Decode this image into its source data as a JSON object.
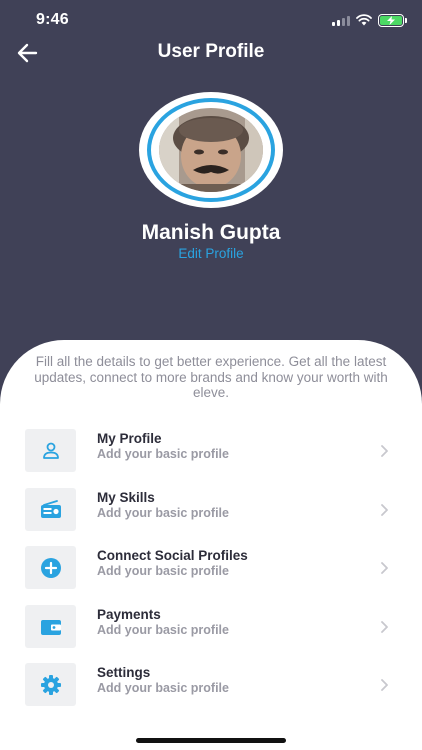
{
  "status_bar": {
    "time": "9:46"
  },
  "header": {
    "title": "User Profile"
  },
  "profile": {
    "name": "Manish Gupta",
    "edit_label": "Edit Profile"
  },
  "intro_text": "Fill all the details to get better experience. Get all the latest updates, connect to more brands and know your worth with eleve.",
  "menu": [
    {
      "title": "My Profile",
      "subtitle": "Add your basic profile",
      "icon": "person-icon"
    },
    {
      "title": "My Skills",
      "subtitle": "Add your basic profile",
      "icon": "radio-icon"
    },
    {
      "title": "Connect Social Profiles",
      "subtitle": "Add your basic profile",
      "icon": "add-circle-icon"
    },
    {
      "title": "Payments",
      "subtitle": "Add your basic profile",
      "icon": "wallet-icon"
    },
    {
      "title": "Settings",
      "subtitle": "Add your basic profile",
      "icon": "gear-icon"
    }
  ],
  "colors": {
    "header_bg": "#404157",
    "accent": "#2aa3e0",
    "icon_box": "#eff0f2",
    "battery": "#4cd964"
  }
}
